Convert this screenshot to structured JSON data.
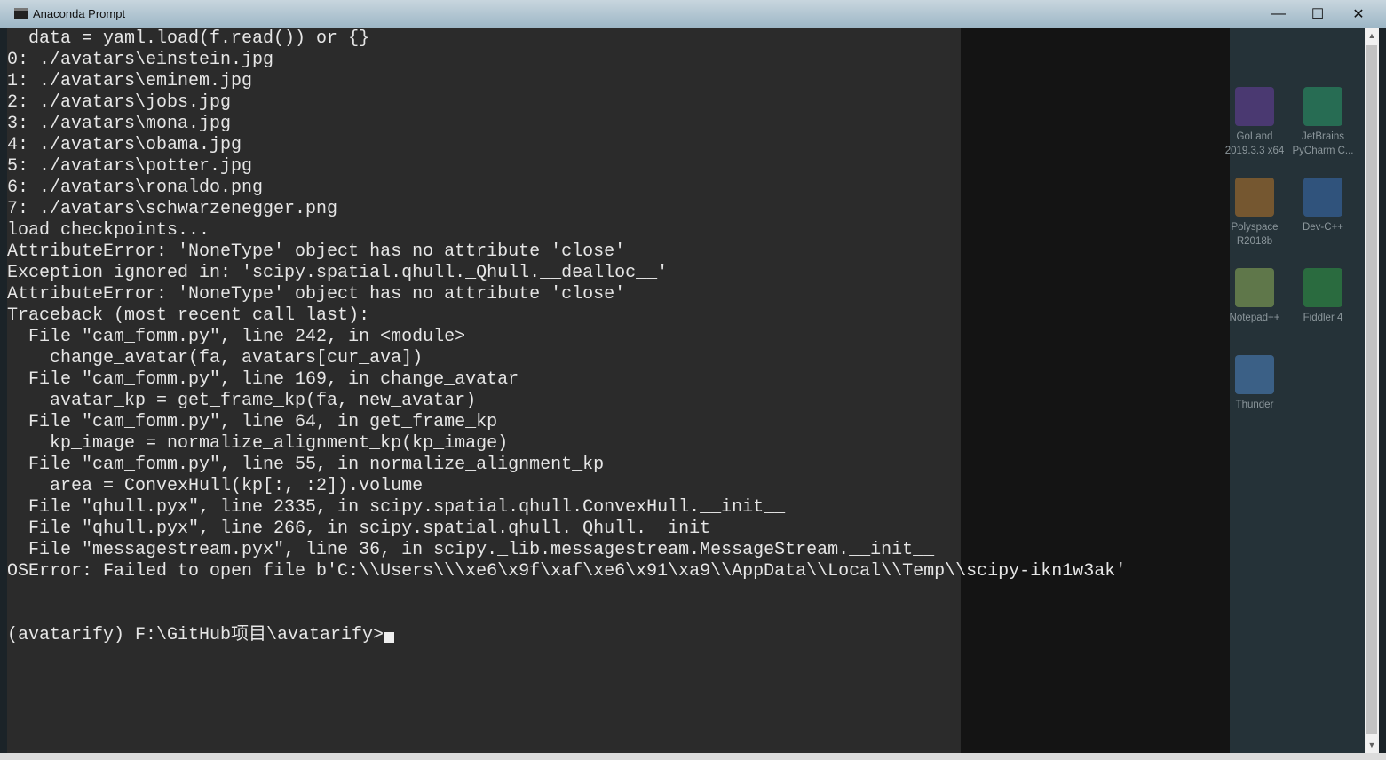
{
  "window": {
    "title": "Anaconda Prompt",
    "controls": {
      "minimize": "—",
      "maximize": "☐",
      "close": "✕"
    }
  },
  "terminal": {
    "lines": [
      "  data = yaml.load(f.read()) or {}",
      "0: ./avatars\\einstein.jpg",
      "1: ./avatars\\eminem.jpg",
      "2: ./avatars\\jobs.jpg",
      "3: ./avatars\\mona.jpg",
      "4: ./avatars\\obama.jpg",
      "5: ./avatars\\potter.jpg",
      "6: ./avatars\\ronaldo.png",
      "7: ./avatars\\schwarzenegger.png",
      "load checkpoints...",
      "AttributeError: 'NoneType' object has no attribute 'close'",
      "Exception ignored in: 'scipy.spatial.qhull._Qhull.__dealloc__'",
      "AttributeError: 'NoneType' object has no attribute 'close'",
      "Traceback (most recent call last):",
      "  File \"cam_fomm.py\", line 242, in <module>",
      "    change_avatar(fa, avatars[cur_ava])",
      "  File \"cam_fomm.py\", line 169, in change_avatar",
      "    avatar_kp = get_frame_kp(fa, new_avatar)",
      "  File \"cam_fomm.py\", line 64, in get_frame_kp",
      "    kp_image = normalize_alignment_kp(kp_image)",
      "  File \"cam_fomm.py\", line 55, in normalize_alignment_kp",
      "    area = ConvexHull(kp[:, :2]).volume",
      "  File \"qhull.pyx\", line 2335, in scipy.spatial.qhull.ConvexHull.__init__",
      "  File \"qhull.pyx\", line 266, in scipy.spatial.qhull._Qhull.__init__",
      "  File \"messagestream.pyx\", line 36, in scipy._lib.messagestream.MessageStream.__init__",
      "OSError: Failed to open file b'C:\\\\Users\\\\\\xe6\\x9f\\xaf\\xe6\\x91\\xa9\\\\AppData\\\\Local\\\\Temp\\\\scipy-ikn1w3ak'",
      "",
      ""
    ],
    "prompt": "(avatarify) F:\\GitHub项目\\avatarify>"
  },
  "desktop_icons": [
    {
      "label": "GoLand 2019.3.3 x64",
      "color": "#6a3fa0"
    },
    {
      "label": "JetBrains PyCharm C...",
      "color": "#2a9c6a"
    },
    {
      "label": "Polyspace R2018b",
      "color": "#b8772a"
    },
    {
      "label": "Dev-C++",
      "color": "#3a6fb5"
    },
    {
      "label": "Notepad++",
      "color": "#8fb05a"
    },
    {
      "label": "Fiddler 4",
      "color": "#2f9a45"
    },
    {
      "label": "Thunder",
      "color": "#4f86c6"
    }
  ]
}
